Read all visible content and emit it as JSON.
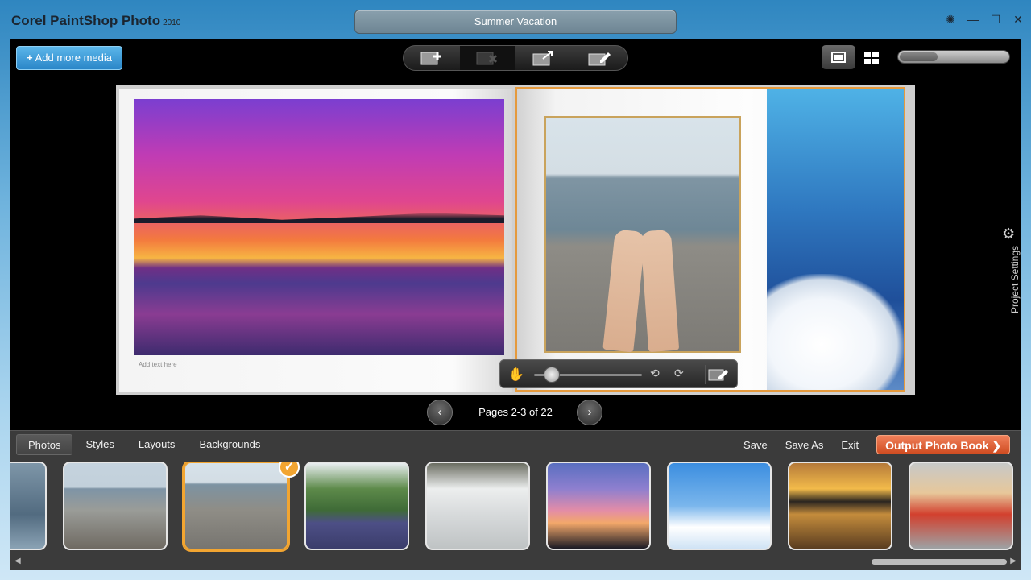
{
  "app": {
    "name": "Corel PaintShop Photo",
    "version": "2010"
  },
  "project": {
    "title": "Summer Vacation"
  },
  "window_controls": {
    "tools_icon": "sparkle-icon",
    "min": "—",
    "max": "☐",
    "close": "✕"
  },
  "toolbar": {
    "add_media_label": "Add more media",
    "tools": [
      {
        "icon": "add-page-icon",
        "enabled": true
      },
      {
        "icon": "delete-page-icon",
        "enabled": false
      },
      {
        "icon": "export-page-icon",
        "enabled": true
      },
      {
        "icon": "edit-page-icon",
        "enabled": true
      }
    ],
    "zoom_level": 0.35
  },
  "book": {
    "left_page": {
      "text_placeholder": "Add text here"
    },
    "pagination": {
      "label": "Pages 2-3 of 22",
      "prev": "‹",
      "next": "›"
    }
  },
  "side_panel": {
    "label": "Project Settings"
  },
  "tray": {
    "tabs": [
      {
        "label": "Photos",
        "active": true
      },
      {
        "label": "Styles",
        "active": false
      },
      {
        "label": "Layouts",
        "active": false
      },
      {
        "label": "Backgrounds",
        "active": false
      }
    ],
    "actions": {
      "save": "Save",
      "save_as": "Save As",
      "exit": "Exit",
      "output": "Output Photo Book ❯"
    },
    "thumbnails": [
      {
        "subject": "swimmer",
        "selected": false
      },
      {
        "subject": "beach-people",
        "selected": false
      },
      {
        "subject": "feet-on-beach",
        "selected": true
      },
      {
        "subject": "dinner-table",
        "selected": false
      },
      {
        "subject": "boat",
        "selected": false
      },
      {
        "subject": "twilight-tree",
        "selected": false
      },
      {
        "subject": "sky-clouds",
        "selected": false
      },
      {
        "subject": "lake-sunset",
        "selected": false
      },
      {
        "subject": "child-in-boat",
        "selected": false
      }
    ]
  },
  "colors": {
    "accent_orange": "#f2a531",
    "output_button": "#e0683c",
    "add_media_blue": "#3a9ad8"
  }
}
